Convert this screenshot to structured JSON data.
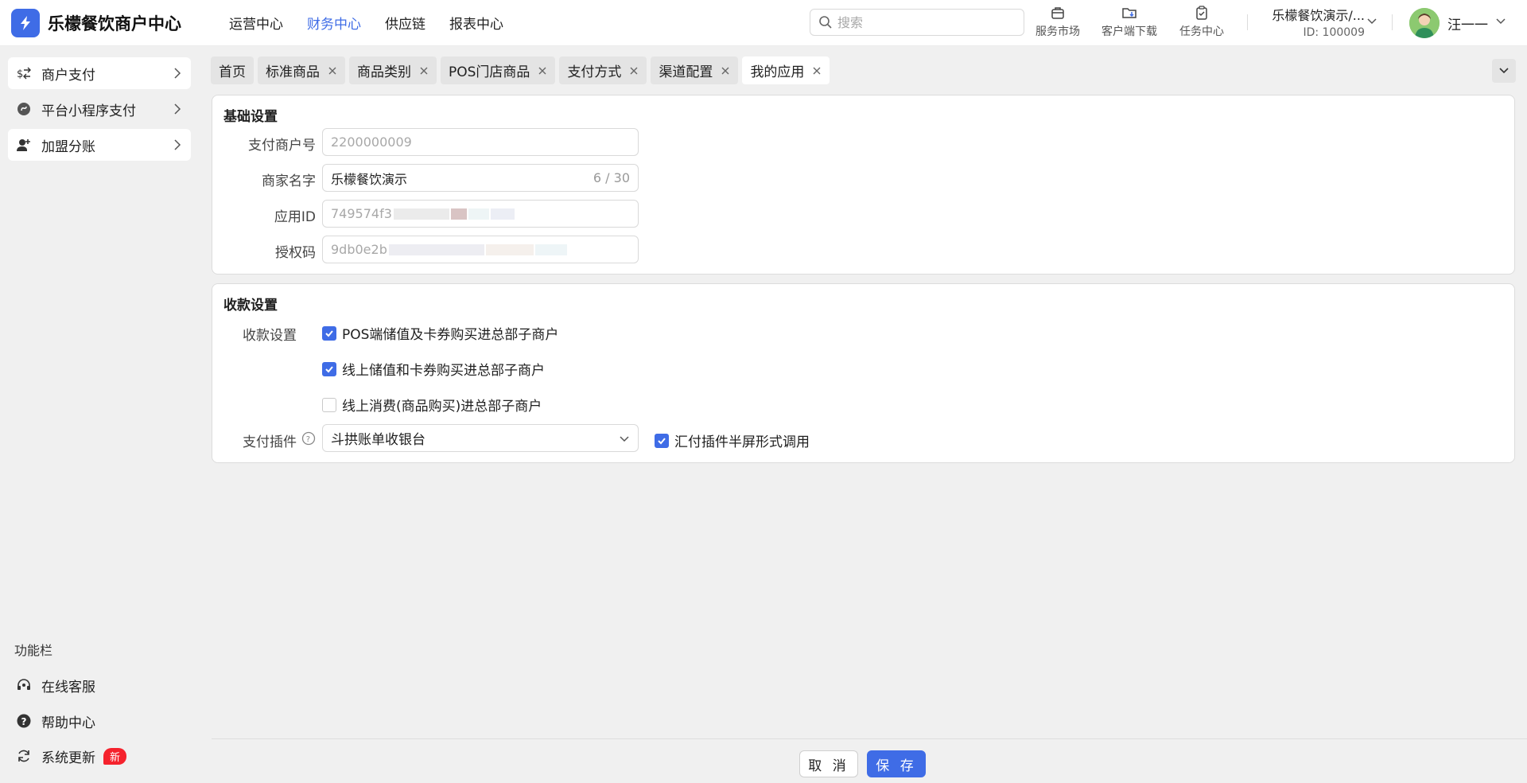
{
  "app": {
    "title": "乐檬餐饮商户中心"
  },
  "nav": [
    {
      "label": "运营中心"
    },
    {
      "label": "财务中心"
    },
    {
      "label": "供应链"
    },
    {
      "label": "报表中心"
    }
  ],
  "search": {
    "placeholder": "搜索"
  },
  "tools": {
    "market": "服务市场",
    "download": "客户端下载",
    "tasks": "任务中心"
  },
  "merchant": {
    "name": "乐檬餐饮演示/...",
    "id": "ID: 100009"
  },
  "user": {
    "name": "汪一一"
  },
  "sidebar": {
    "items": [
      {
        "label": "商户支付"
      },
      {
        "label": "平台小程序支付"
      },
      {
        "label": "加盟分账"
      }
    ],
    "function_title": "功能栏",
    "functions": [
      {
        "label": "在线客服"
      },
      {
        "label": "帮助中心"
      },
      {
        "label": "系统更新",
        "badge": "新"
      }
    ]
  },
  "tabs": [
    {
      "label": "首页"
    },
    {
      "label": "标准商品"
    },
    {
      "label": "商品类别"
    },
    {
      "label": "POS门店商品"
    },
    {
      "label": "支付方式"
    },
    {
      "label": "渠道配置"
    },
    {
      "label": "我的应用"
    }
  ],
  "basic": {
    "title": "基础设置",
    "merchant_no_label": "支付商户号",
    "merchant_no_value": "2200000009",
    "shop_name_label": "商家名字",
    "shop_name_value": "乐檬餐饮演示",
    "shop_name_count": "6 / 30",
    "app_id_label": "应用ID",
    "app_id_value": "749574f3",
    "auth_code_label": "授权码",
    "auth_code_value": "9db0e2b"
  },
  "collect": {
    "title": "收款设置",
    "settings_label": "收款设置",
    "options": [
      {
        "label": "POS端储值及卡券购买进总部子商户",
        "checked": true
      },
      {
        "label": "线上储值和卡券购买进总部子商户",
        "checked": true
      },
      {
        "label": "线上消费(商品购买)进总部子商户",
        "checked": false
      }
    ],
    "plugin_label": "支付插件",
    "plugin_value": "斗拱账单收银台",
    "half_screen_label": "汇付插件半屏形式调用"
  },
  "footer": {
    "cancel": "取 消",
    "save": "保 存"
  },
  "colors": {
    "accent": "#3f6ce6",
    "badge": "#f5222d"
  }
}
